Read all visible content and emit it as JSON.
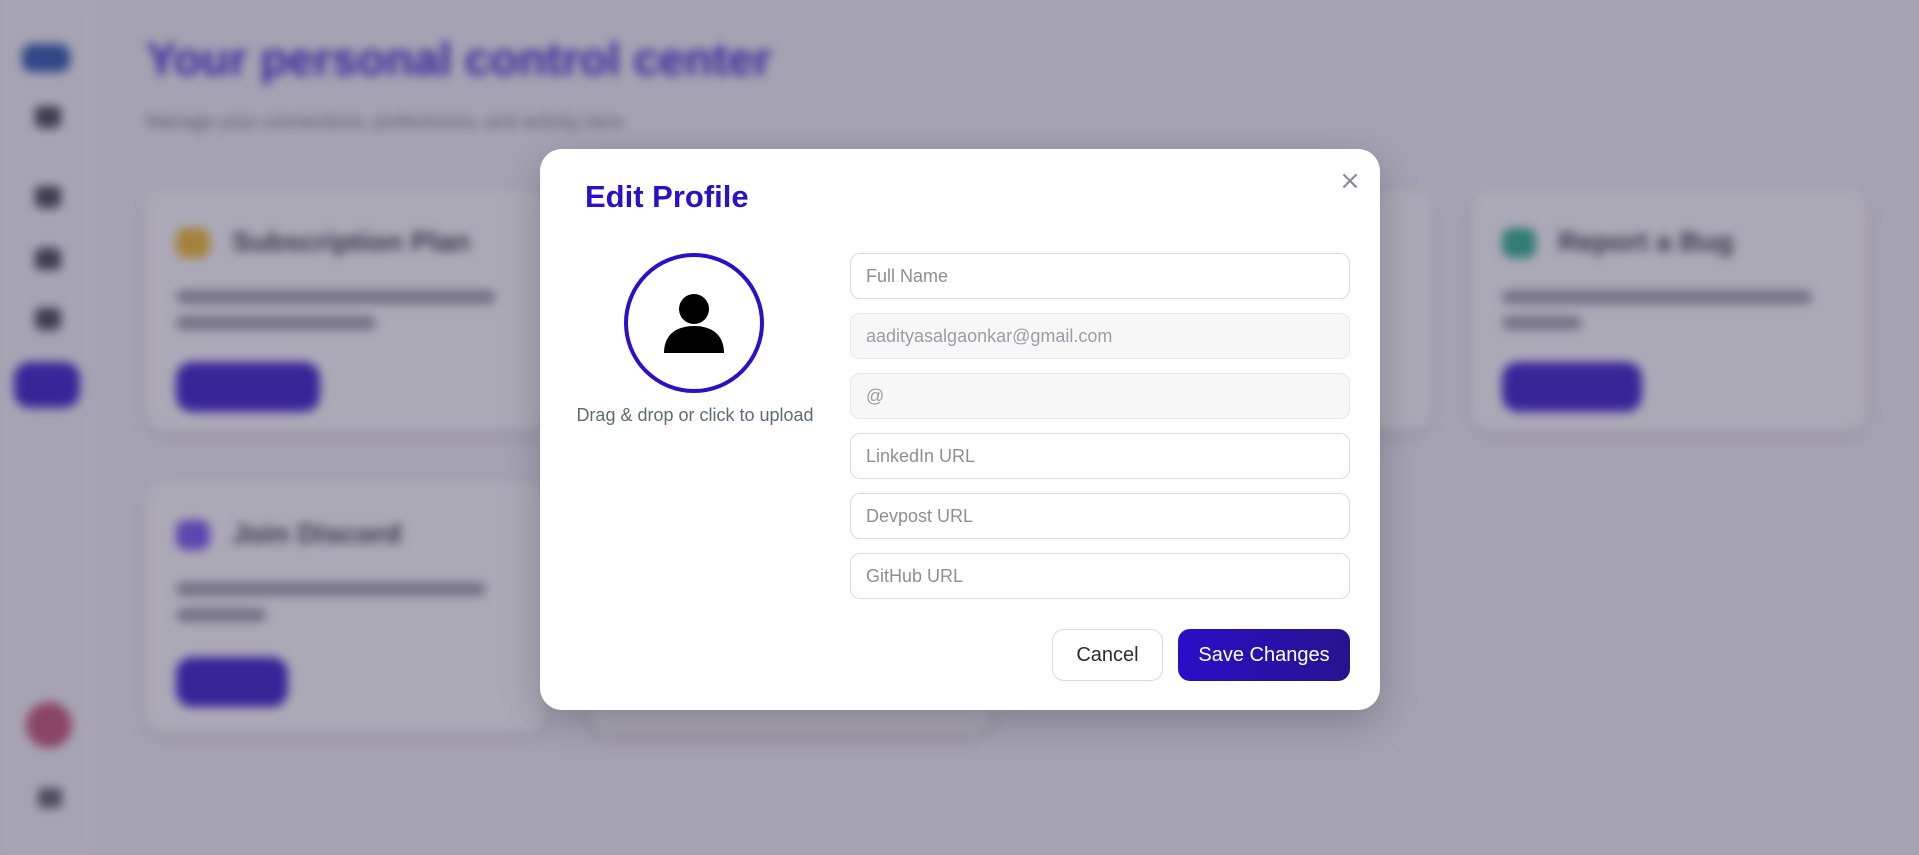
{
  "background": {
    "title": "Your personal control center",
    "subtitle": "Manage your connections, preferences, and activity here",
    "cards": [
      {
        "title": "Subscription Plan",
        "color": "#f2b81f"
      },
      {
        "title": "Report a Bug",
        "color": "#1fae86"
      },
      {
        "title": "Join Discord",
        "color": "#6b4ef0"
      }
    ]
  },
  "modal": {
    "title": "Edit Profile",
    "close_symbol": "×",
    "avatar_icon": "user-silhouette-icon",
    "upload_text": "Drag & drop or click to upload",
    "fields": {
      "full_name": {
        "placeholder": "Full Name",
        "value": ""
      },
      "email": {
        "placeholder": "aadityasalgaonkar@gmail.com",
        "value": ""
      },
      "username": {
        "placeholder": "@",
        "value": ""
      },
      "linkedin": {
        "placeholder": "LinkedIn URL",
        "value": ""
      },
      "devpost": {
        "placeholder": "Devpost URL",
        "value": ""
      },
      "github": {
        "placeholder": "GitHub URL",
        "value": ""
      }
    },
    "cancel_label": "Cancel",
    "save_label": "Save Changes"
  },
  "colors": {
    "accent": "#2a10c9",
    "overlay": "rgba(70,65,95,0.45)"
  }
}
